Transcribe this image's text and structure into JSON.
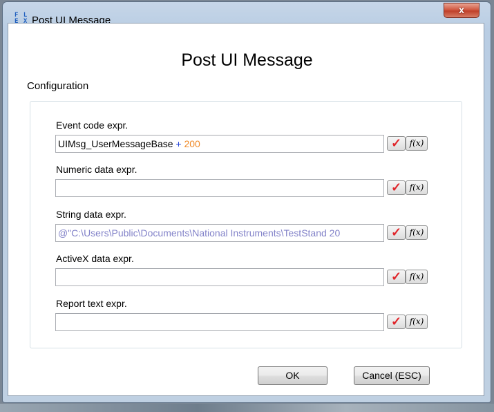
{
  "window": {
    "icon_glyph": "F L E X",
    "title": "Post UI Message",
    "close_glyph": "x"
  },
  "dialog": {
    "heading": "Post UI Message",
    "group_label": "Configuration"
  },
  "fields": [
    {
      "label": "Event code expr.",
      "value_parts": [
        "UIMsg_UserMessageBase",
        "+",
        "200"
      ]
    },
    {
      "label": "Numeric data expr.",
      "value": ""
    },
    {
      "label": "String data expr.",
      "value": "@\"C:\\Users\\Public\\Documents\\National Instruments\\TestStand 20"
    },
    {
      "label": "ActiveX data expr.",
      "value": ""
    },
    {
      "label": "Report text expr.",
      "value": ""
    }
  ],
  "icons": {
    "check": "check-icon",
    "function": "function-icon"
  },
  "check_glyph": "✓",
  "fx_label": "f(x)",
  "buttons": {
    "ok": "OK",
    "cancel": "Cancel (ESC)"
  },
  "colors": {
    "check": "#e0262b",
    "operator": "#1f3fd7",
    "number": "#f08a28",
    "string_literal": "#8383c9"
  }
}
